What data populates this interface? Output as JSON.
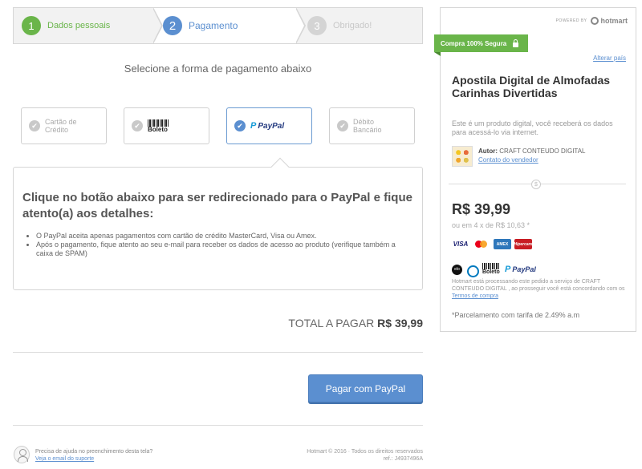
{
  "steps": [
    {
      "number": "1",
      "label": "Dados pessoais"
    },
    {
      "number": "2",
      "label": "Pagamento"
    },
    {
      "number": "3",
      "label": "Obrigado!"
    }
  ],
  "select_title": "Selecione a forma de pagamento abaixo",
  "methods": {
    "card": "Cartão de Crédito",
    "boleto": "Boleto",
    "paypal": "PayPal",
    "debit": "Débito Bancário"
  },
  "info": {
    "title": "Clique no botão abaixo para ser redirecionado para o PayPal e fique atento(a) aos detalhes:",
    "items": [
      "O PayPal aceita apenas pagamentos com cartão de crédito MasterCard, Visa ou Amex.",
      "Após o pagamento, fique atento ao seu e-mail para receber os dados de acesso ao produto (verifique também a caixa de SPAM)"
    ]
  },
  "total": {
    "label": "TOTAL A PAGAR",
    "value": "R$ 39,99"
  },
  "pay_button": "Pagar com PayPal",
  "footer": {
    "help_text": "Precisa de ajuda no preenchimento desta tela?",
    "help_link": "Veja o email do suporte",
    "copyright": "Hotmart © 2016 · Todos os direitos reservados",
    "ref": "ref.: J4937496A"
  },
  "sidebar": {
    "powered_by": "POWERED BY",
    "brand": "hotmart",
    "secure_label": "Compra 100% Segura",
    "change_country": "Alterar país",
    "product_title": "Apostila Digital de Almofadas Carinhas Divertidas",
    "product_desc": "Este é um produto digital, você receberá os dados para acessá-lo via internet.",
    "author_label": "Autor:",
    "author_name": "CRAFT CONTEUDO DIGITAL",
    "seller_contact": "Contato do vendedor",
    "divider_symbol": "$",
    "price": "R$ 39,99",
    "installments": "ou em 4 x de R$ 10,63 *",
    "card_brands": [
      "VISA",
      "MasterCard",
      "AMEX",
      "Hipercard"
    ],
    "other_methods": [
      "elo",
      "Diners",
      "Boleto",
      "PayPal"
    ],
    "legal_text": "Hotmart está processando este pedido a serviço de CRAFT CONTEUDO DIGITAL , ao prosseguir você está concordando com os",
    "terms_link": "Termos de compra",
    "installment_note": "*Parcelamento com tarifa de 2.49% a.m"
  },
  "colors": {
    "green": "#6ab54a",
    "blue": "#5b8fd0",
    "gray_step": "#d4d4d4"
  }
}
